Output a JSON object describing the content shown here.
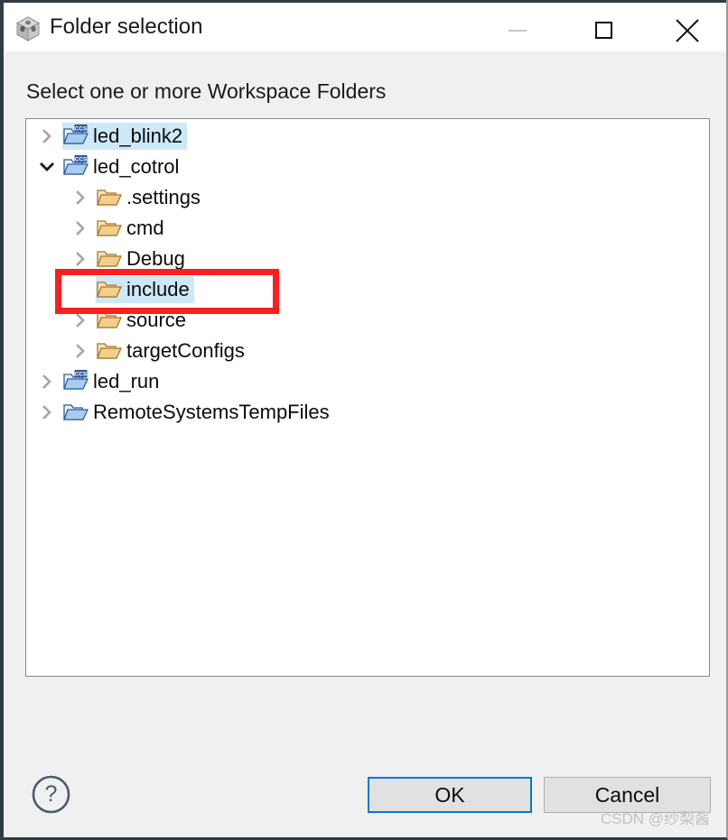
{
  "window": {
    "title": "Folder selection",
    "icon": "cube-icon",
    "controls": {
      "minimize": "minimize-icon",
      "maximize": "maximize-icon",
      "close": "close-icon"
    }
  },
  "header": {
    "instruction": "Select one or more Workspace Folders"
  },
  "tree": {
    "items": [
      {
        "label": "led_blink2",
        "depth": 0,
        "expander": "collapsed",
        "icon": "ccs-project-folder-icon",
        "selected": true
      },
      {
        "label": "led_cotrol",
        "depth": 0,
        "expander": "expanded",
        "icon": "ccs-project-folder-icon",
        "selected": false
      },
      {
        "label": ".settings",
        "depth": 1,
        "expander": "collapsed",
        "icon": "folder-icon",
        "selected": false
      },
      {
        "label": "cmd",
        "depth": 1,
        "expander": "collapsed",
        "icon": "folder-icon",
        "selected": false
      },
      {
        "label": "Debug",
        "depth": 1,
        "expander": "collapsed",
        "icon": "folder-icon",
        "selected": false
      },
      {
        "label": "include",
        "depth": 1,
        "expander": "none",
        "icon": "folder-icon",
        "selected": true
      },
      {
        "label": "source",
        "depth": 1,
        "expander": "collapsed",
        "icon": "folder-icon",
        "selected": false
      },
      {
        "label": "targetConfigs",
        "depth": 1,
        "expander": "collapsed",
        "icon": "folder-icon",
        "selected": false
      },
      {
        "label": "led_run",
        "depth": 0,
        "expander": "collapsed",
        "icon": "ccs-project-folder-icon",
        "selected": false
      },
      {
        "label": "RemoteSystemsTempFiles",
        "depth": 0,
        "expander": "collapsed",
        "icon": "blue-folder-icon",
        "selected": false
      }
    ]
  },
  "annotation": {
    "shape": "rectangle",
    "color": "#fb1f1f",
    "targets": "include"
  },
  "footer": {
    "help_icon": "help-question-icon",
    "ok_label": "OK",
    "cancel_label": "Cancel"
  },
  "watermark": {
    "text": "CSDN @纱梨酱"
  },
  "colors": {
    "selection": "#cde8f7",
    "focus_border": "#0078d7",
    "annotation": "#fb1f1f",
    "dialog_bg": "#f0f0f0",
    "panel_bg": "#ffffff"
  }
}
